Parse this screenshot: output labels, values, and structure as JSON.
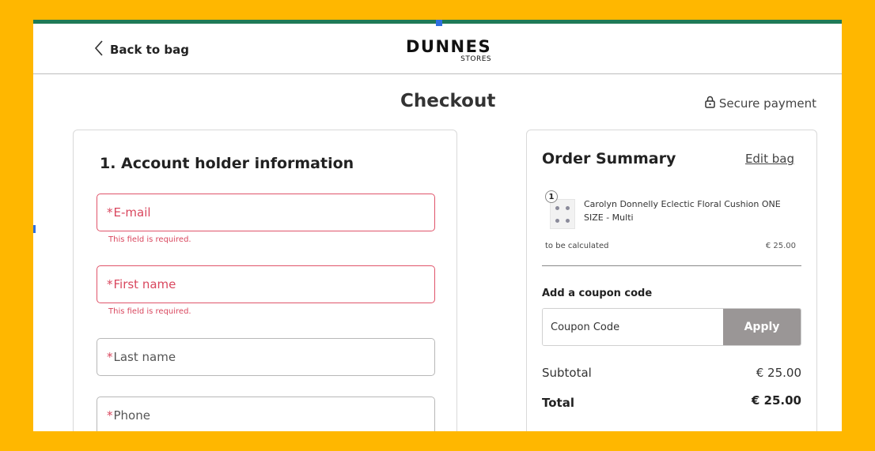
{
  "header": {
    "back_label": "Back to bag",
    "logo_main": "DUNNES",
    "logo_sub": "STORES"
  },
  "page": {
    "title": "Checkout",
    "secure_label": "Secure payment"
  },
  "account": {
    "section_title": "1.  Account holder information",
    "required_marker": "*",
    "fields": [
      {
        "label": "E-mail",
        "error": "This field is required."
      },
      {
        "label": "First name",
        "error": "This field is required."
      },
      {
        "label": "Last name"
      },
      {
        "label": "Phone"
      }
    ]
  },
  "summary": {
    "title": "Order Summary",
    "edit_label": "Edit bag",
    "item": {
      "quantity": "1",
      "name": "Carolyn Donnelly Eclectic Floral Cushion ONE SIZE - Multi"
    },
    "shipping_label": "to be calculated",
    "shipping_price": "€ 25.00",
    "coupon_label": "Add a coupon code",
    "coupon_placeholder": "Coupon Code",
    "apply_label": "Apply",
    "subtotal_label": "Subtotal",
    "subtotal_value": "€ 25.00",
    "total_label": "Total",
    "total_value": "€ 25.00"
  },
  "colors": {
    "background": "#FFB700",
    "accent_bar": "#1f7a57",
    "error": "#d9475e",
    "apply_button": "#9a9696"
  }
}
